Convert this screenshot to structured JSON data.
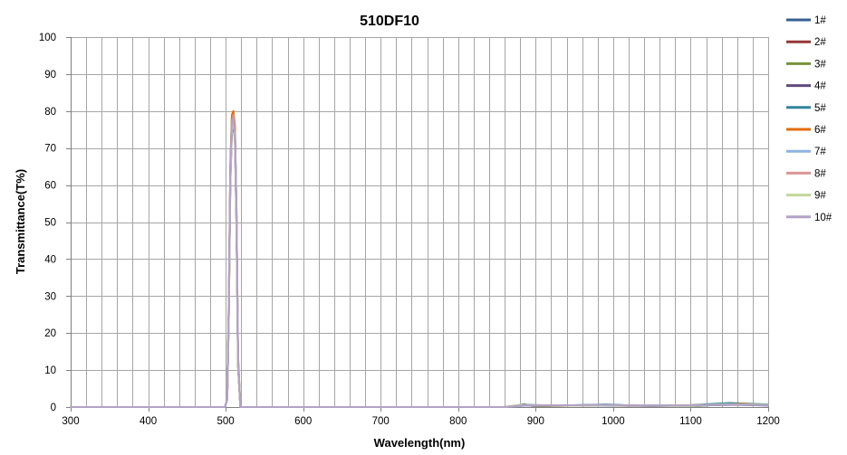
{
  "chart_data": {
    "type": "line",
    "title": "510DF10",
    "xlabel": "Wavelength(nm)",
    "ylabel": "Transmittance(T%)",
    "xlim": [
      300,
      1200
    ],
    "ylim": [
      0,
      100
    ],
    "xticks": [
      300,
      400,
      500,
      600,
      700,
      800,
      900,
      1000,
      1100,
      1200
    ],
    "yticks": [
      0,
      10,
      20,
      30,
      40,
      50,
      60,
      70,
      80,
      90,
      100
    ],
    "grid": true,
    "legend_position": "right",
    "series": [
      {
        "name": "1#",
        "color": "#376092",
        "x": [
          300,
          499,
          502,
          504,
          506,
          508,
          510,
          512,
          514,
          516,
          519,
          860,
          875,
          885,
          895,
          940,
          990,
          1050,
          1100,
          1150,
          1160,
          1200
        ],
        "y": [
          0,
          0,
          2,
          25,
          62,
          76,
          78,
          74,
          50,
          12,
          0,
          0,
          0.4,
          0.8,
          0.3,
          0.4,
          0.6,
          0.3,
          0.4,
          1.0,
          0.6,
          0.5
        ]
      },
      {
        "name": "2#",
        "color": "#953735",
        "x": [
          300,
          499,
          502,
          504,
          506,
          508,
          510,
          512,
          514,
          516,
          519,
          860,
          880,
          900,
          950,
          1000,
          1050,
          1100,
          1150,
          1200
        ],
        "y": [
          0,
          0,
          2,
          24,
          61,
          75,
          77,
          73,
          49,
          11,
          0,
          0,
          0.5,
          0.3,
          0.4,
          0.5,
          0.3,
          0.4,
          0.7,
          0.5
        ]
      },
      {
        "name": "3#",
        "color": "#77933c",
        "x": [
          300,
          499,
          502,
          504,
          506,
          508,
          510,
          512,
          514,
          516,
          519,
          860,
          885,
          905,
          960,
          1010,
          1060,
          1110,
          1155,
          1200
        ],
        "y": [
          0,
          0,
          2,
          26,
          63,
          77,
          79,
          74,
          51,
          12,
          0,
          0,
          0.7,
          0.2,
          0.5,
          0.4,
          0.4,
          0.3,
          0.8,
          0.6
        ]
      },
      {
        "name": "4#",
        "color": "#604a7b",
        "x": [
          300,
          499,
          502,
          504,
          506,
          508,
          510,
          512,
          514,
          516,
          519,
          860,
          880,
          920,
          970,
          1020,
          1080,
          1130,
          1160,
          1200
        ],
        "y": [
          0,
          0,
          2,
          25,
          60,
          74,
          76,
          72,
          48,
          11,
          0,
          0,
          0.4,
          0.3,
          0.5,
          0.3,
          0.4,
          0.5,
          0.6,
          0.4
        ]
      },
      {
        "name": "5#",
        "color": "#31859c",
        "x": [
          300,
          499,
          502,
          504,
          506,
          508,
          510,
          512,
          514,
          516,
          519,
          860,
          885,
          930,
          990,
          1040,
          1090,
          1150,
          1200
        ],
        "y": [
          0,
          0,
          2,
          27,
          64,
          78,
          79,
          75,
          52,
          13,
          0,
          0,
          0.6,
          0.4,
          0.7,
          0.3,
          0.4,
          1.1,
          0.7
        ]
      },
      {
        "name": "6#",
        "color": "#e46c0a",
        "x": [
          300,
          499,
          502,
          504,
          506,
          508,
          510,
          512,
          514,
          516,
          519,
          860,
          880,
          930,
          980,
          1030,
          1090,
          1140,
          1165,
          1200
        ],
        "y": [
          0,
          0,
          2,
          28,
          66,
          79,
          80,
          76,
          53,
          14,
          0,
          0,
          0.5,
          0.3,
          0.5,
          0.4,
          0.4,
          0.6,
          0.9,
          0.5
        ]
      },
      {
        "name": "7#",
        "color": "#8eb4e3",
        "x": [
          300,
          499,
          502,
          504,
          506,
          508,
          510,
          512,
          514,
          516,
          519,
          860,
          890,
          940,
          1000,
          1050,
          1100,
          1150,
          1200
        ],
        "y": [
          0,
          0,
          2,
          25,
          62,
          76,
          78,
          73,
          50,
          12,
          0,
          0,
          0.4,
          0.5,
          0.3,
          0.5,
          0.4,
          0.6,
          0.5
        ]
      },
      {
        "name": "8#",
        "color": "#d99694",
        "x": [
          300,
          499,
          502,
          504,
          506,
          508,
          510,
          512,
          514,
          516,
          519,
          860,
          885,
          935,
          985,
          1040,
          1095,
          1150,
          1200
        ],
        "y": [
          0,
          0,
          2,
          26,
          63,
          77,
          79,
          74,
          51,
          12,
          0,
          0,
          0.5,
          0.4,
          0.5,
          0.3,
          0.5,
          0.7,
          0.6
        ]
      },
      {
        "name": "9#",
        "color": "#c3d69b",
        "x": [
          300,
          499,
          502,
          504,
          506,
          508,
          510,
          512,
          514,
          516,
          519,
          860,
          880,
          925,
          975,
          1025,
          1085,
          1145,
          1200
        ],
        "y": [
          0,
          0,
          2,
          24,
          60,
          75,
          77,
          72,
          49,
          11,
          0,
          0,
          0.6,
          0.3,
          0.5,
          0.4,
          0.3,
          0.8,
          0.6
        ]
      },
      {
        "name": "10#",
        "color": "#b3a2c7",
        "x": [
          300,
          499,
          502,
          504,
          506,
          508,
          510,
          512,
          514,
          516,
          519,
          860,
          885,
          930,
          980,
          1035,
          1090,
          1150,
          1200
        ],
        "y": [
          0,
          0,
          2,
          26,
          64,
          77,
          78,
          74,
          52,
          13,
          0,
          0,
          0.5,
          0.4,
          0.6,
          0.4,
          0.4,
          0.7,
          0.5
        ]
      }
    ]
  }
}
